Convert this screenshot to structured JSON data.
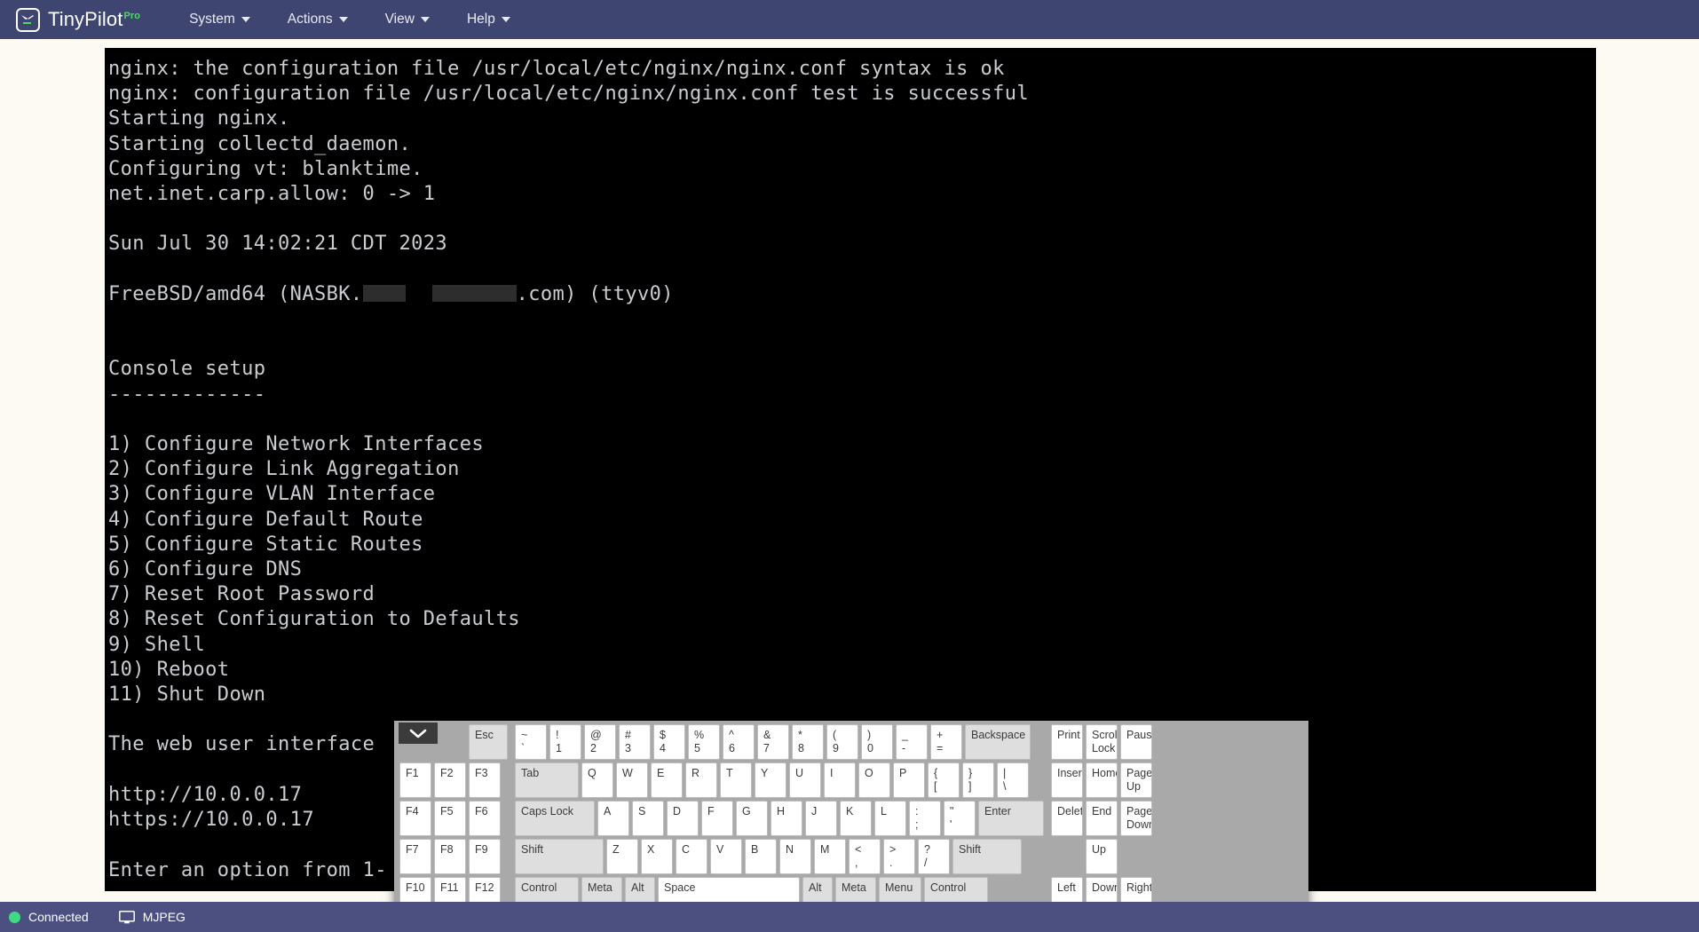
{
  "app": {
    "brand_name": "TinyPilot",
    "brand_badge": "Pro",
    "logo_icon": "tinypilot-logo-icon"
  },
  "navbar": {
    "items": [
      {
        "label": "System",
        "icon": "chevron-down-icon"
      },
      {
        "label": "Actions",
        "icon": "chevron-down-icon"
      },
      {
        "label": "View",
        "icon": "chevron-down-icon"
      },
      {
        "label": "Help",
        "icon": "chevron-down-icon"
      }
    ]
  },
  "console": {
    "lines": [
      "nginx: the configuration file /usr/local/etc/nginx/nginx.conf syntax is ok",
      "nginx: configuration file /usr/local/etc/nginx/nginx.conf test is successful",
      "Starting nginx.",
      "Starting collectd_daemon.",
      "Configuring vt: blanktime.",
      "net.inet.carp.allow: 0 -> 1",
      "",
      "Sun Jul 30 14:02:21 CDT 2023",
      "",
      "__HOSTLINE__",
      "",
      "",
      "Console setup",
      "-------------",
      "",
      "1) Configure Network Interfaces",
      "2) Configure Link Aggregation",
      "3) Configure VLAN Interface",
      "4) Configure Default Route",
      "5) Configure Static Routes",
      "6) Configure DNS",
      "7) Reset Root Password",
      "8) Reset Configuration to Defaults",
      "9) Shell",
      "10) Reboot",
      "11) Shut Down",
      "",
      "The web user interface",
      "",
      "http://10.0.0.17",
      "https://10.0.0.17",
      "",
      "Enter an option from 1-"
    ],
    "host_prefix": "FreeBSD/amd64 (NASBK.",
    "host_suffix": ".com) (ttyv0)",
    "host_redacted": true
  },
  "keyboard": {
    "collapse_icon": "chevron-down-icon",
    "fn_block": [
      [
        "",
        "",
        "Esc"
      ],
      [
        "F1",
        "F2",
        "F3"
      ],
      [
        "F4",
        "F5",
        "F6"
      ],
      [
        "F7",
        "F8",
        "F9"
      ],
      [
        "F10",
        "F11",
        "F12"
      ]
    ],
    "main_rows": [
      [
        {
          "top": "~",
          "bottom": "`"
        },
        {
          "top": "!",
          "bottom": "1"
        },
        {
          "top": "@",
          "bottom": "2"
        },
        {
          "top": "#",
          "bottom": "3"
        },
        {
          "top": "$",
          "bottom": "4"
        },
        {
          "top": "%",
          "bottom": "5"
        },
        {
          "top": "^",
          "bottom": "6"
        },
        {
          "top": "&",
          "bottom": "7"
        },
        {
          "top": "*",
          "bottom": "8"
        },
        {
          "top": "(",
          "bottom": "9"
        },
        {
          "top": ")",
          "bottom": "0"
        },
        {
          "top": "_",
          "bottom": "-"
        },
        {
          "top": "+",
          "bottom": "="
        },
        {
          "top": "Backspace",
          "bottom": "",
          "mod": true,
          "width": "w-bksp"
        }
      ],
      [
        {
          "top": "Tab",
          "bottom": "",
          "mod": true,
          "width": "w-tab"
        },
        {
          "top": "Q",
          "bottom": ""
        },
        {
          "top": "W",
          "bottom": ""
        },
        {
          "top": "E",
          "bottom": ""
        },
        {
          "top": "R",
          "bottom": ""
        },
        {
          "top": "T",
          "bottom": ""
        },
        {
          "top": "Y",
          "bottom": ""
        },
        {
          "top": "U",
          "bottom": ""
        },
        {
          "top": "I",
          "bottom": ""
        },
        {
          "top": "O",
          "bottom": ""
        },
        {
          "top": "P",
          "bottom": ""
        },
        {
          "top": "{",
          "bottom": "["
        },
        {
          "top": "}",
          "bottom": "]"
        },
        {
          "top": "|",
          "bottom": "\\"
        }
      ],
      [
        {
          "top": "Caps Lock",
          "bottom": "",
          "mod": true,
          "width": "w-caps"
        },
        {
          "top": "A",
          "bottom": ""
        },
        {
          "top": "S",
          "bottom": ""
        },
        {
          "top": "D",
          "bottom": ""
        },
        {
          "top": "F",
          "bottom": ""
        },
        {
          "top": "G",
          "bottom": ""
        },
        {
          "top": "H",
          "bottom": ""
        },
        {
          "top": "J",
          "bottom": ""
        },
        {
          "top": "K",
          "bottom": ""
        },
        {
          "top": "L",
          "bottom": ""
        },
        {
          "top": ":",
          "bottom": ";"
        },
        {
          "top": "\"",
          "bottom": "'"
        },
        {
          "top": "Enter",
          "bottom": "",
          "mod": true,
          "width": "w-enter"
        }
      ],
      [
        {
          "top": "Shift",
          "bottom": "",
          "mod": true,
          "width": "w-shiftL"
        },
        {
          "top": "Z",
          "bottom": ""
        },
        {
          "top": "X",
          "bottom": ""
        },
        {
          "top": "C",
          "bottom": ""
        },
        {
          "top": "V",
          "bottom": ""
        },
        {
          "top": "B",
          "bottom": ""
        },
        {
          "top": "N",
          "bottom": ""
        },
        {
          "top": "M",
          "bottom": ""
        },
        {
          "top": "<",
          "bottom": ","
        },
        {
          "top": ">",
          "bottom": "."
        },
        {
          "top": "?",
          "bottom": "/"
        },
        {
          "top": "Shift",
          "bottom": "",
          "mod": true,
          "width": "w-shiftR"
        }
      ],
      [
        {
          "top": "Control",
          "bottom": "",
          "mod": true,
          "width": "w-ctrl"
        },
        {
          "top": "Meta",
          "bottom": "",
          "mod": true,
          "width": "w-meta"
        },
        {
          "top": "Alt",
          "bottom": "",
          "mod": true,
          "width": "w-alt"
        },
        {
          "top": "Space",
          "bottom": "",
          "width": "w-space"
        },
        {
          "top": "Alt",
          "bottom": "",
          "mod": true,
          "width": "w-alt"
        },
        {
          "top": "Meta",
          "bottom": "",
          "mod": true,
          "width": "w-meta"
        },
        {
          "top": "Menu",
          "bottom": "",
          "mod": true,
          "width": "w-menu"
        },
        {
          "top": "Control",
          "bottom": "",
          "mod": true,
          "width": "w-ctrl"
        }
      ]
    ],
    "nav_rows": [
      [
        "Print",
        "Scroll Lock",
        "Pause"
      ],
      [
        "Insert",
        "Home",
        "Page Up"
      ],
      [
        "Delete",
        "End",
        "Page Down"
      ],
      [
        "",
        "Up",
        ""
      ],
      [
        "Left",
        "Down",
        "Right"
      ]
    ]
  },
  "statusbar": {
    "connection": {
      "label": "Connected",
      "icon": "status-dot-icon",
      "color": "#3ddc84"
    },
    "stream": {
      "label": "MJPEG",
      "icon": "monitor-icon"
    }
  },
  "colors": {
    "navbar": "#3f4571",
    "statusbar": "#4b5081",
    "page_bg": "#fdf9f3",
    "screen_bg": "#000000",
    "terminal_fg": "#c9cdd1",
    "accent_green": "#4cd964",
    "keyboard_bg": "#a9a9a9"
  }
}
